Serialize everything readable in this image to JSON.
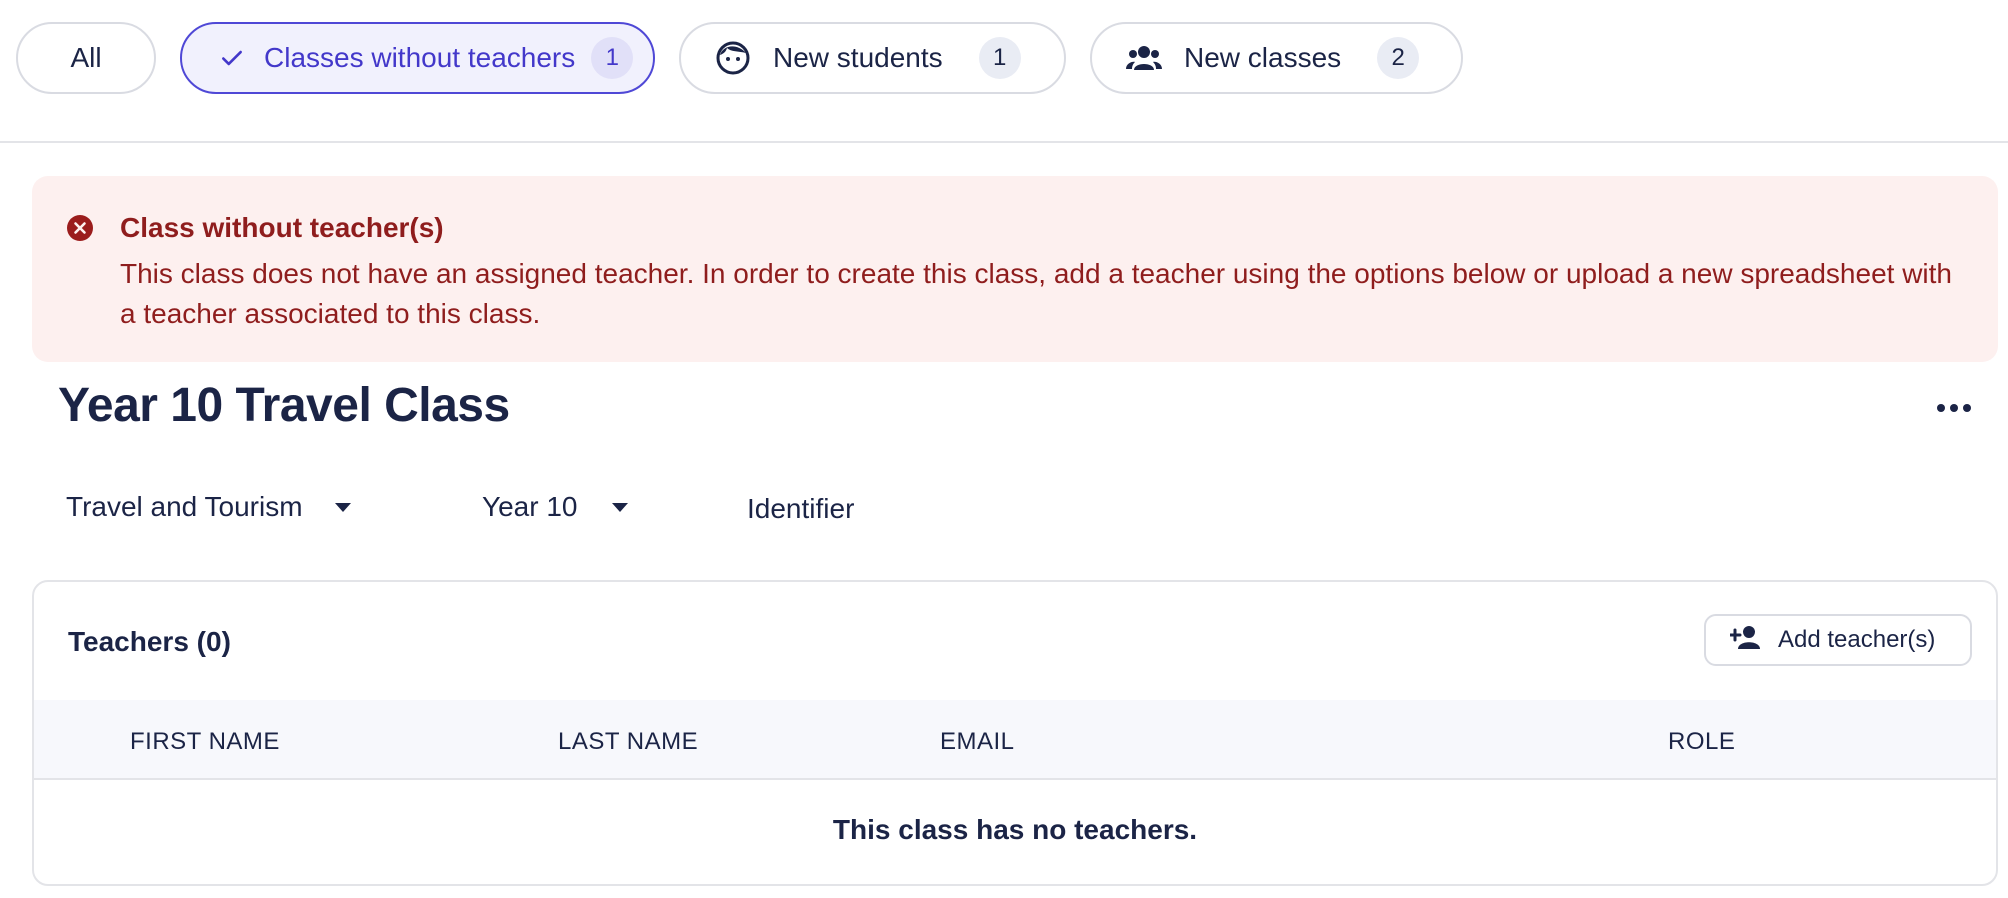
{
  "filters": {
    "all": {
      "label": "All"
    },
    "classes_without_teachers": {
      "label": "Classes without teachers",
      "count": "1",
      "icon": "check-icon",
      "active": true
    },
    "new_students": {
      "label": "New students",
      "count": "1",
      "icon": "student-face-icon"
    },
    "new_classes": {
      "label": "New classes",
      "count": "2",
      "icon": "group-icon"
    }
  },
  "alert": {
    "icon": "error-circle-icon",
    "title": "Class without teacher(s)",
    "message": "This class does not have an assigned teacher. In order to create this class, add a teacher using the options below or upload a new spreadsheet with a teacher associated to this class."
  },
  "class": {
    "title": "Year 10 Travel Class",
    "subject": "Travel and Tourism",
    "year": "Year 10",
    "identifier_placeholder": "Identifier"
  },
  "teachers": {
    "title": "Teachers (0)",
    "add_button": "Add teacher(s)",
    "columns": [
      "FIRST NAME",
      "LAST NAME",
      "EMAIL",
      "ROLE"
    ],
    "rows": [],
    "empty_message": "This class has no teachers."
  },
  "colors": {
    "primary_text": "#1b2446",
    "accent": "#4f48d6",
    "error_bg": "#fdf0ef",
    "error_text": "#8f1d1d"
  }
}
